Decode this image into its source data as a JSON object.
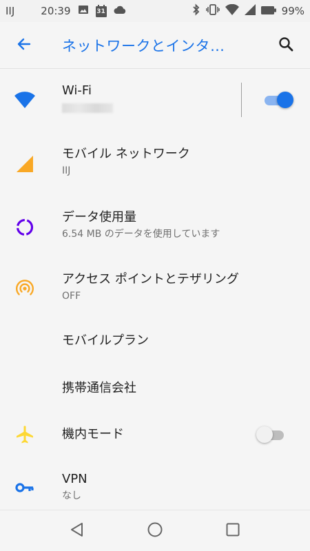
{
  "status_bar": {
    "carrier": "IIJ",
    "time": "20:39",
    "calendar_day": "31",
    "battery": "99%"
  },
  "app_bar": {
    "title": "ネットワークとインタ…"
  },
  "items": [
    {
      "title": "Wi-Fi",
      "icon": "wifi-icon",
      "color": "#1a73e8",
      "toggle": true
    },
    {
      "title": "モバイル ネットワーク",
      "subtitle": "IIJ",
      "icon": "signal-icon",
      "color": "#f9a825"
    },
    {
      "title": "データ使用量",
      "subtitle": "6.54 MB のデータを使用しています",
      "icon": "data-usage-icon",
      "color": "#6200ea"
    },
    {
      "title": "アクセス ポイントとテザリング",
      "subtitle": "OFF",
      "icon": "hotspot-icon",
      "color": "#f9a825"
    },
    {
      "title": "モバイルプラン"
    },
    {
      "title": "携帯通信会社"
    },
    {
      "title": "機内モード",
      "icon": "airplane-icon",
      "color": "#fdd835",
      "toggle": false
    },
    {
      "title": "VPN",
      "subtitle": "なし",
      "icon": "vpn-key-icon",
      "color": "#1a73e8"
    }
  ],
  "colors": {
    "accent": "#1a73e8",
    "background": "#f5f5f5"
  }
}
